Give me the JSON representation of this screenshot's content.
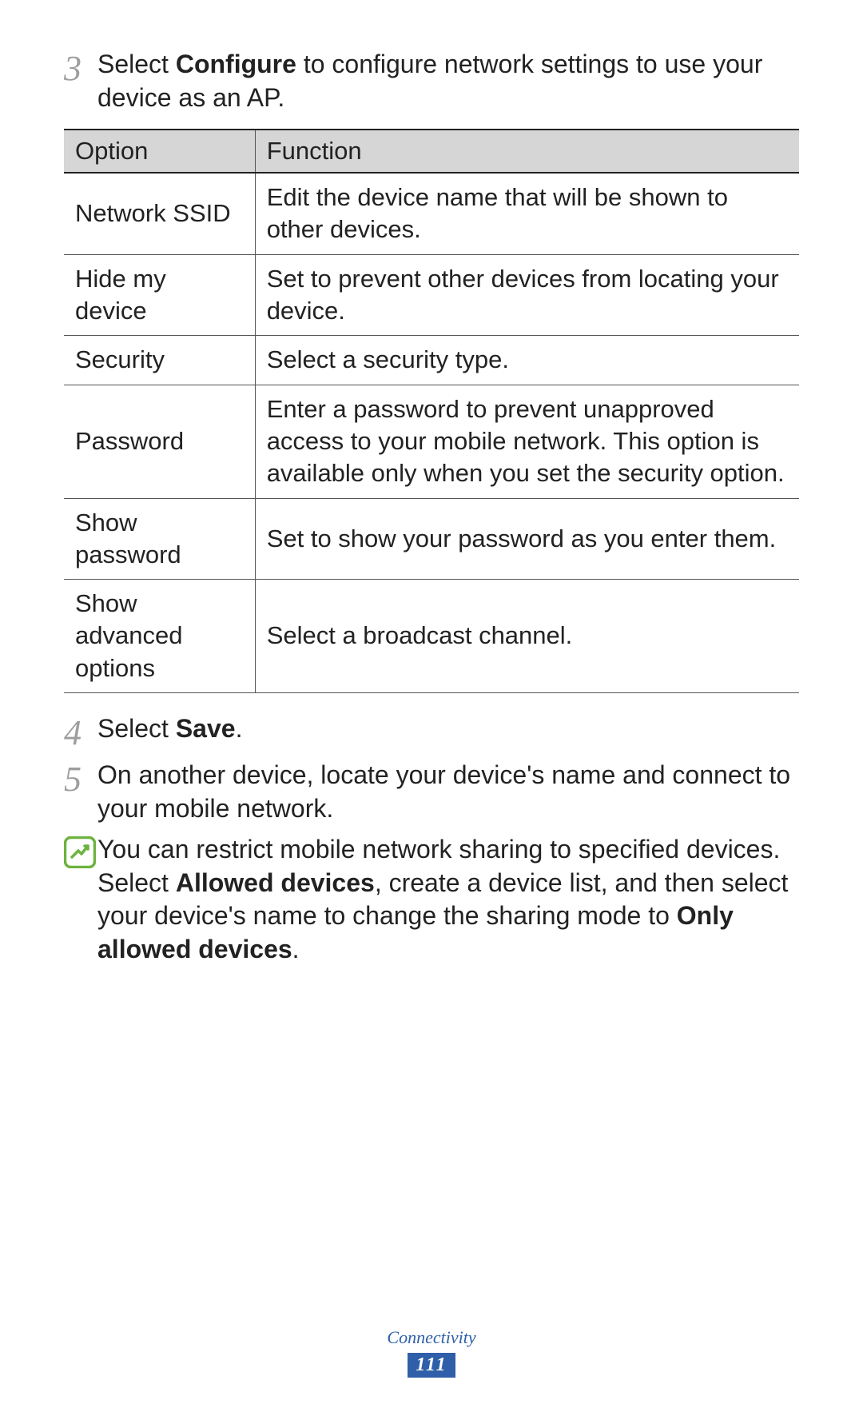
{
  "steps": {
    "s3": {
      "num": "3",
      "pre": "Select ",
      "bold": "Configure",
      "post": " to configure network settings to use your device as an AP."
    },
    "s4": {
      "num": "4",
      "pre": "Select ",
      "bold": "Save",
      "post": "."
    },
    "s5": {
      "num": "5",
      "text": "On another device, locate your device's name and connect to your mobile network."
    }
  },
  "table": {
    "headers": {
      "option": "Option",
      "function": "Function"
    },
    "rows": [
      {
        "option": "Network SSID",
        "function": "Edit the device name that will be shown to other devices."
      },
      {
        "option": "Hide my device",
        "function": "Set to prevent other devices from locating your device."
      },
      {
        "option": "Security",
        "function": "Select a security type."
      },
      {
        "option": "Password",
        "function": "Enter a password to prevent unapproved access to your mobile network. This option is available only when you set the security option."
      },
      {
        "option": "Show password",
        "function": "Set to show your password as you enter them."
      },
      {
        "option": "Show advanced options",
        "function": "Select a broadcast channel."
      }
    ]
  },
  "note": {
    "pre": "You can restrict mobile network sharing to specified devices. Select ",
    "bold1": "Allowed devices",
    "mid": ", create a device list, and then select your device's name to change the sharing mode to ",
    "bold2": "Only allowed devices",
    "post": "."
  },
  "footer": {
    "section": "Connectivity",
    "page": "111"
  }
}
